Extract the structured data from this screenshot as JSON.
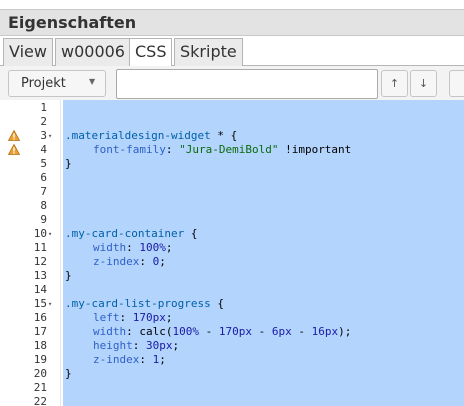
{
  "panel": {
    "title": "Eigenschaften"
  },
  "tabs": [
    {
      "label": "View",
      "active": false
    },
    {
      "label": "w00006",
      "active": false
    },
    {
      "label": "CSS",
      "active": true
    },
    {
      "label": "Skripte",
      "active": false
    }
  ],
  "toolbar": {
    "scope_select": "Projekt",
    "scope_caret": "▼",
    "search_value": "",
    "up_label": "↑",
    "down_label": "↓"
  },
  "editor": {
    "line_numbers": [
      "1",
      "2",
      "3",
      "4",
      "5",
      "6",
      "7",
      "8",
      "9",
      "10",
      "11",
      "12",
      "13",
      "14",
      "15",
      "16",
      "17",
      "18",
      "19",
      "20",
      "21",
      "22"
    ],
    "fold_marker": "▾",
    "warning_lines": [
      "3",
      "4"
    ],
    "warning_color": "#f0a030"
  },
  "code": {
    "l3_selector": ".materialdesign-widget",
    "l3_rest": " * {",
    "l4_prop": "font-family",
    "l4_colon": ": ",
    "l4_value": "\"Jura-DemiBold\"",
    "l4_important": " !important",
    "l5_close": "}",
    "l10_selector": ".my-card-container",
    "l10_rest": " {",
    "l11_prop": "width",
    "l11_colon": ": ",
    "l11_value": "100%",
    "l11_semi": ";",
    "l12_prop": "z-index",
    "l12_colon": ": ",
    "l12_value": "0",
    "l12_semi": ";",
    "l13_close": "}",
    "l15_selector": ".my-card-list-progress",
    "l15_rest": " {",
    "l16_prop": "left",
    "l16_colon": ": ",
    "l16_value": "170px",
    "l16_semi": ";",
    "l17_prop": "width",
    "l17_colon": ": ",
    "l17_value": "calc(",
    "l17_a": "100%",
    "l17_m1": " - ",
    "l17_b": "170px",
    "l17_m2": " - ",
    "l17_c": "6px",
    "l17_m3": " - ",
    "l17_d": "16px",
    "l17_end": ");",
    "l18_prop": "height",
    "l18_colon": ": ",
    "l18_value": "30px",
    "l18_semi": ";",
    "l19_prop": "z-index",
    "l19_colon": ": ",
    "l19_value": "1",
    "l19_semi": ";",
    "l20_close": "}"
  }
}
